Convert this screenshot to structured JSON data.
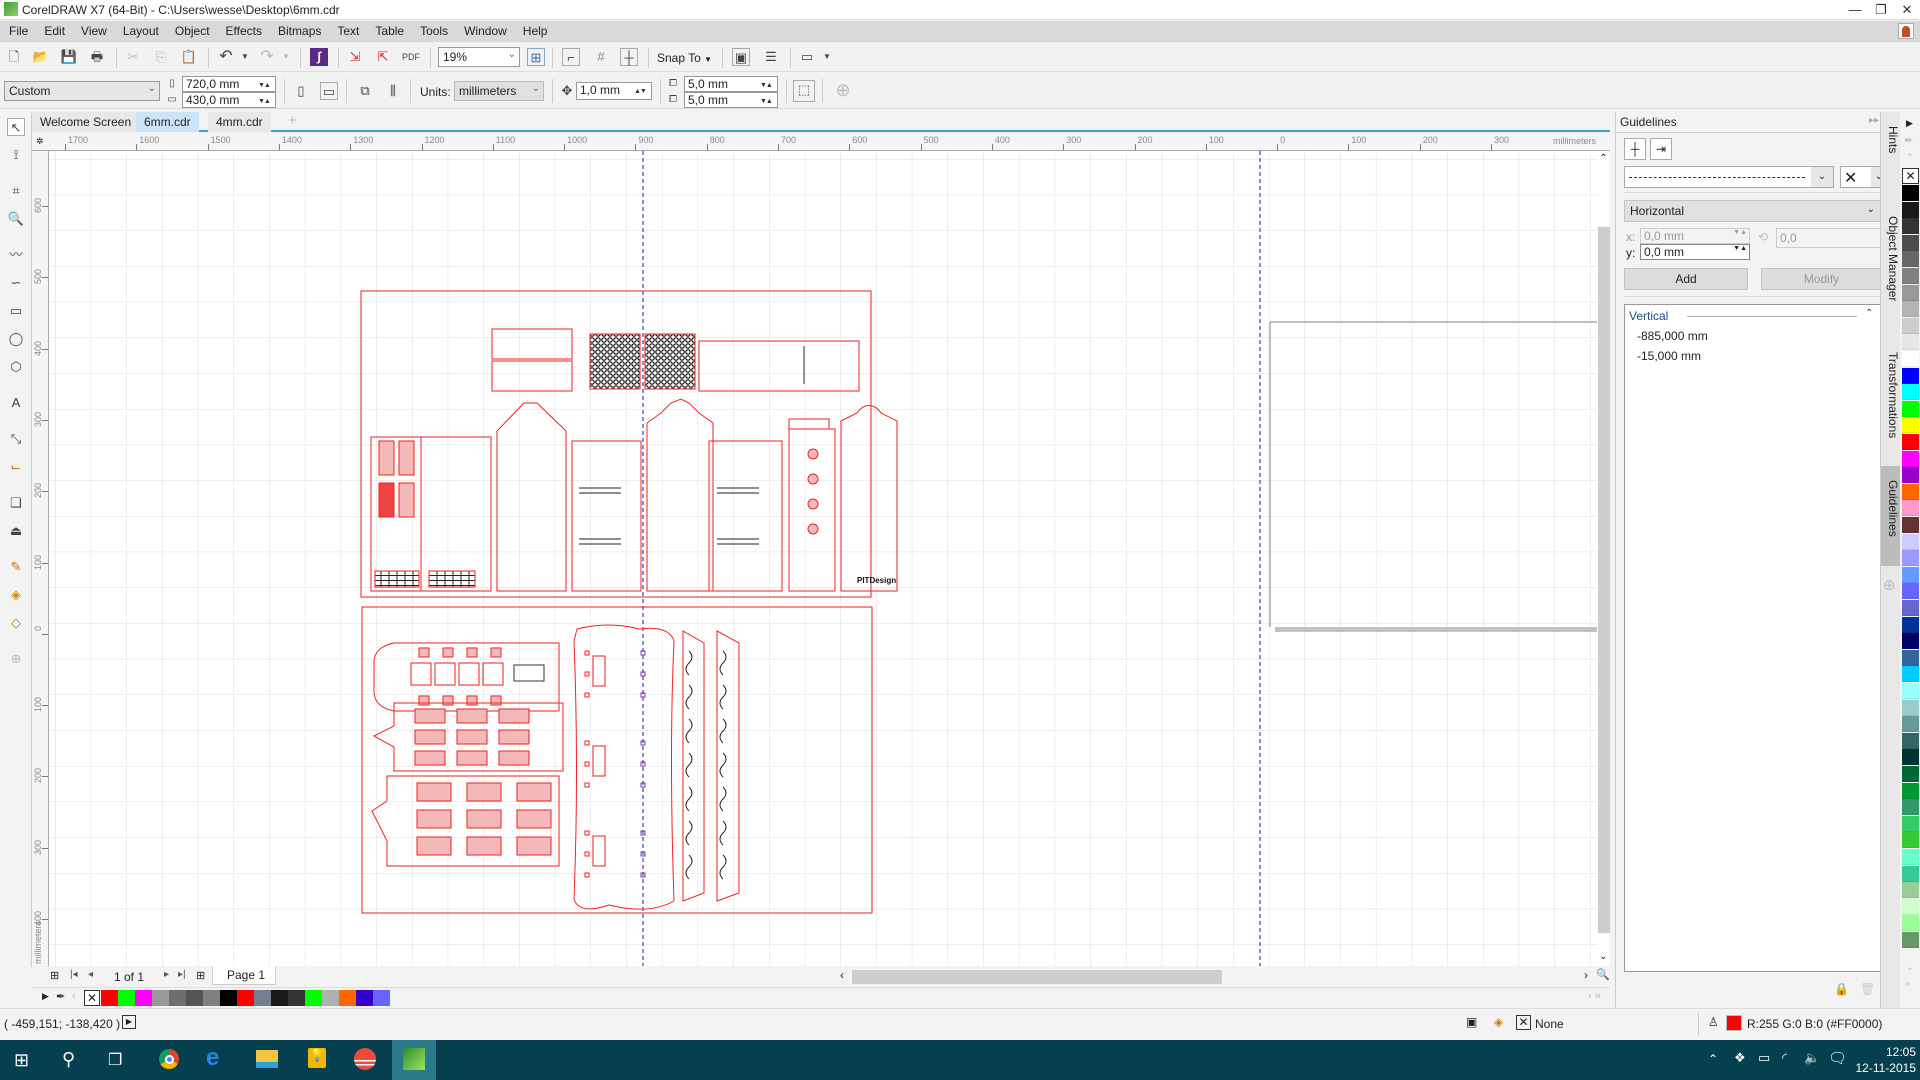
{
  "window": {
    "title": "CorelDRAW X7 (64-Bit) - C:\\Users\\wesse\\Desktop\\6mm.cdr",
    "minimize": "—",
    "restore": "❐",
    "close": "✕"
  },
  "menu": [
    "File",
    "Edit",
    "View",
    "Layout",
    "Object",
    "Effects",
    "Bitmaps",
    "Text",
    "Table",
    "Tools",
    "Window",
    "Help"
  ],
  "toolbar": {
    "zoom_level": "19%",
    "snap_to_label": "Snap To",
    "icons": [
      "new-icon",
      "open-icon",
      "save-icon",
      "print-icon",
      "cut-icon",
      "copy-icon",
      "paste-icon",
      "undo-icon",
      "redo-icon",
      "search-content-icon",
      "import-icon",
      "export-icon",
      "export-pdf-icon",
      "zoom-fit-icon",
      "show-rulers-icon",
      "show-grid-icon",
      "show-guidelines-icon",
      "options-icon",
      "app-launcher-icon",
      "welcome-icon"
    ]
  },
  "property_bar": {
    "page_preset": "Custom",
    "page_width": "720,0 mm",
    "page_height": "430,0 mm",
    "units_label": "Units:",
    "units_value": "millimeters",
    "nudge": "1,0 mm",
    "dup_x": "5,0 mm",
    "dup_y": "5,0 mm"
  },
  "doc_tabs": [
    {
      "label": "Welcome Screen",
      "active": false
    },
    {
      "label": "6mm.cdr",
      "active": true
    },
    {
      "label": "4mm.cdr",
      "active": false
    }
  ],
  "rulers": {
    "horizontal_ticks": [
      "1700",
      "1600",
      "1500",
      "1400",
      "1300",
      "1200",
      "1100",
      "1000",
      "900",
      "800",
      "700",
      "600",
      "500",
      "400",
      "300",
      "200",
      "100",
      "0",
      "100",
      "200",
      "300"
    ],
    "horizontal_unit": "millimeters",
    "vertical_ticks": [
      "600",
      "500",
      "400",
      "300",
      "200",
      "100",
      "0",
      "100",
      "200",
      "300",
      "400"
    ],
    "vertical_unit": "millimeters"
  },
  "page_nav": {
    "counter": "1 of 1",
    "page_tab": "Page 1"
  },
  "doc_palette": [
    "#ff0000",
    "#00ff00",
    "#ff00ff",
    "#999999",
    "#6e6e6e",
    "#555555",
    "#808080",
    "#000000",
    "#ff0000",
    "#708090",
    "#1a1a1a",
    "#333333",
    "#00ff00",
    "#b0b0b0",
    "#ff6600",
    "#3300cc",
    "#6666ff"
  ],
  "status": {
    "cursor_position": "( -459,151; -138,420 )",
    "fill_label": "None",
    "outline_color": "R:255 G:0 B:0 (#FF0000)",
    "outline_hex": "#FF0000"
  },
  "docker": {
    "title": "Guidelines",
    "guide_type": "Horizontal",
    "x_label": "x:",
    "x_value": "0,0 mm",
    "y_label": "y:",
    "y_value": "0,0 mm",
    "angle_value": "0,0",
    "add_label": "Add",
    "modify_label": "Modify",
    "list_header": "Vertical",
    "guidelines": [
      "-885,000 mm",
      "-15,000 mm"
    ]
  },
  "vertical_tabs": [
    "Hints",
    "Object Manager",
    "Transformations",
    "Guidelines"
  ],
  "color_palette": [
    "#000000",
    "#1a1a1a",
    "#333333",
    "#4d4d4d",
    "#666666",
    "#808080",
    "#999999",
    "#b3b3b3",
    "#cccccc",
    "#e6e6e6",
    "#ffffff",
    "#0000ff",
    "#00ffff",
    "#00ff00",
    "#ffff00",
    "#ff0000",
    "#ff00ff",
    "#9900cc",
    "#ff6600",
    "#ff99cc",
    "#663333",
    "#ccccff",
    "#9999ff",
    "#6699ff",
    "#6666ff",
    "#6666cc",
    "#003399",
    "#000066",
    "#336699",
    "#00ccff",
    "#99ffff",
    "#99cccc",
    "#669999",
    "#336666",
    "#003333",
    "#006633",
    "#009933",
    "#339966",
    "#33cc66",
    "#33cc33",
    "#66ffcc",
    "#33cc99",
    "#99cc99",
    "#ccffcc",
    "#99ff99",
    "#669966"
  ],
  "taskbar": {
    "apps": [
      "start-icon",
      "search-icon",
      "task-view-icon",
      "chrome-icon",
      "edge-icon",
      "file-explorer-icon",
      "tips-icon",
      "app-red-icon",
      "coreldraw-icon"
    ],
    "time": "12:05",
    "date": "12-11-2015"
  },
  "drawing": {
    "outline_color": "#ee2222",
    "guideline_color": "#1a1aa0",
    "sheet_labels": [
      "PITDesign"
    ]
  }
}
